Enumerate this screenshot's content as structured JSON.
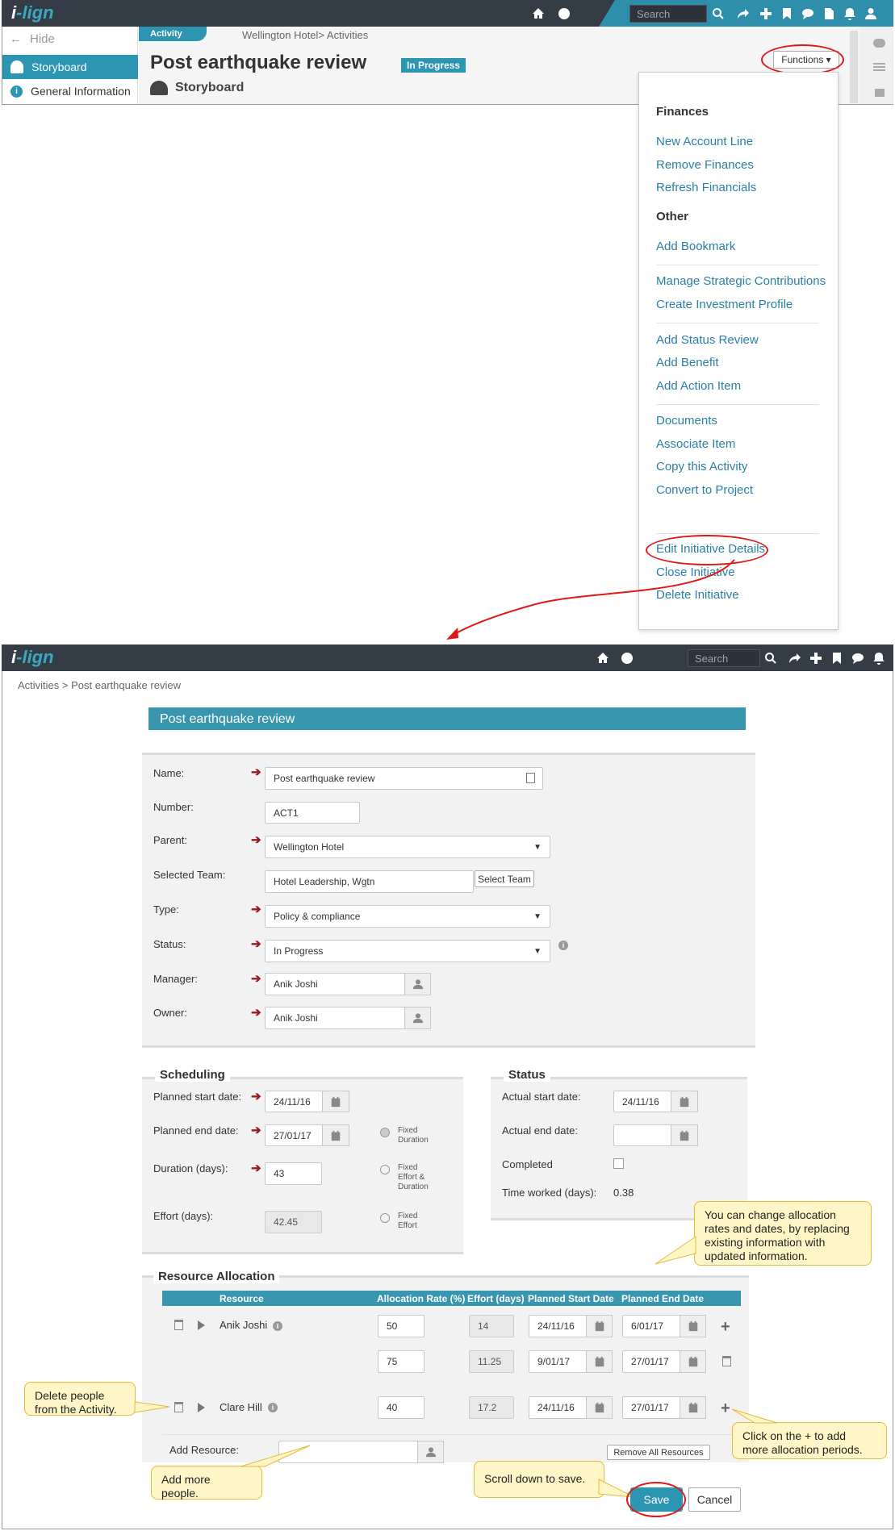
{
  "top": {
    "logo_prefix": "i",
    "logo_rest": "-lign",
    "search_placeholder": "Search",
    "hide_label": "Hide",
    "badge_activity": "Activity",
    "breadcrumb": "Wellington Hotel> Activities",
    "title": "Post earthquake review",
    "status_badge": "In Progress",
    "subtitle": "Storyboard",
    "functions_label": "Functions ▾",
    "sidebar": [
      {
        "label": "Storyboard"
      },
      {
        "label": "General Information"
      }
    ]
  },
  "menu": {
    "finances_heading": "Finances",
    "finances": [
      "New Account Line",
      "Remove Finances",
      "Refresh Financials"
    ],
    "other_heading": "Other",
    "other_a": [
      "Add Bookmark"
    ],
    "other_b": [
      "Manage Strategic Contributions",
      "Create Investment Profile"
    ],
    "other_c": [
      "Add Status Review",
      "Add Benefit",
      "Add Action Item"
    ],
    "other_d": [
      "Documents",
      "Associate Item",
      "Copy this Activity",
      "Convert to Project"
    ],
    "other_e": [
      "Edit Initiative Details",
      "Close Initiative",
      "Delete Initiative"
    ]
  },
  "bottom": {
    "search_placeholder": "Search",
    "breadcrumb": "Activities > Post earthquake review",
    "form_title": "Post earthquake review",
    "labels": {
      "name": "Name:",
      "number": "Number:",
      "parent": "Parent:",
      "team": "Selected Team:",
      "type": "Type:",
      "status": "Status:",
      "manager": "Manager:",
      "owner": "Owner:"
    },
    "values": {
      "name": "Post earthquake review",
      "number": "ACT1",
      "parent": "Wellington Hotel",
      "team": "Hotel Leadership, Wgtn",
      "select_team": "Select Team",
      "type": "Policy & compliance",
      "status": "In Progress",
      "manager": "Anik Joshi",
      "owner": "Anik Joshi"
    },
    "scheduling": {
      "title": "Scheduling",
      "planned_start_label": "Planned start date:",
      "planned_start": "24/11/16",
      "planned_end_label": "Planned end date:",
      "planned_end": "27/01/17",
      "duration_label": "Duration (days):",
      "duration": "43",
      "effort_label": "Effort (days):",
      "effort": "42.45",
      "fixed_duration_1": "Fixed",
      "fixed_duration_2": "Duration",
      "fixed_ed_1": "Fixed",
      "fixed_ed_2": "Effort &",
      "fixed_ed_3": "Duration",
      "fixed_effort_1": "Fixed",
      "fixed_effort_2": "Effort"
    },
    "status_panel": {
      "title": "Status",
      "actual_start_label": "Actual start date:",
      "actual_start": "24/11/16",
      "actual_end_label": "Actual end date:",
      "completed_label": "Completed",
      "time_worked_label": "Time worked (days):",
      "time_worked": "0.38"
    },
    "resource": {
      "title": "Resource Allocation",
      "headers": [
        "Resource",
        "Allocation Rate (%)",
        "Effort (days)",
        "Planned Start Date",
        "Planned End Date"
      ],
      "rows": [
        {
          "name": "Anik Joshi",
          "rate": "50",
          "effort": "14",
          "start": "24/11/16",
          "end": "6/01/17"
        },
        {
          "name": "",
          "rate": "75",
          "effort": "11.25",
          "start": "9/01/17",
          "end": "27/01/17"
        },
        {
          "name": "Clare Hill",
          "rate": "40",
          "effort": "17.2",
          "start": "24/11/16",
          "end": "27/01/17"
        }
      ],
      "add_resource_label": "Add Resource:",
      "remove_all": "Remove All Resources"
    },
    "save": "Save",
    "cancel": "Cancel"
  },
  "callouts": {
    "allocation_1": "You can change allocation",
    "allocation_2": "rates and dates, by replacing",
    "allocation_3": "existing information with",
    "allocation_4": "updated  information.",
    "delete_1": "Delete people",
    "delete_2": "from the Activity.",
    "plus_1": "Click on the + to add",
    "plus_2": "more allocation periods.",
    "add_1": "Add more",
    "add_2": "people.",
    "scroll": "Scroll down to save."
  },
  "colors": {
    "topbar": "#343c46",
    "accent": "#2b95b2",
    "link": "#2a7fa6",
    "callout_bg": "#fff6c8",
    "annotation_red": "#e01818"
  }
}
